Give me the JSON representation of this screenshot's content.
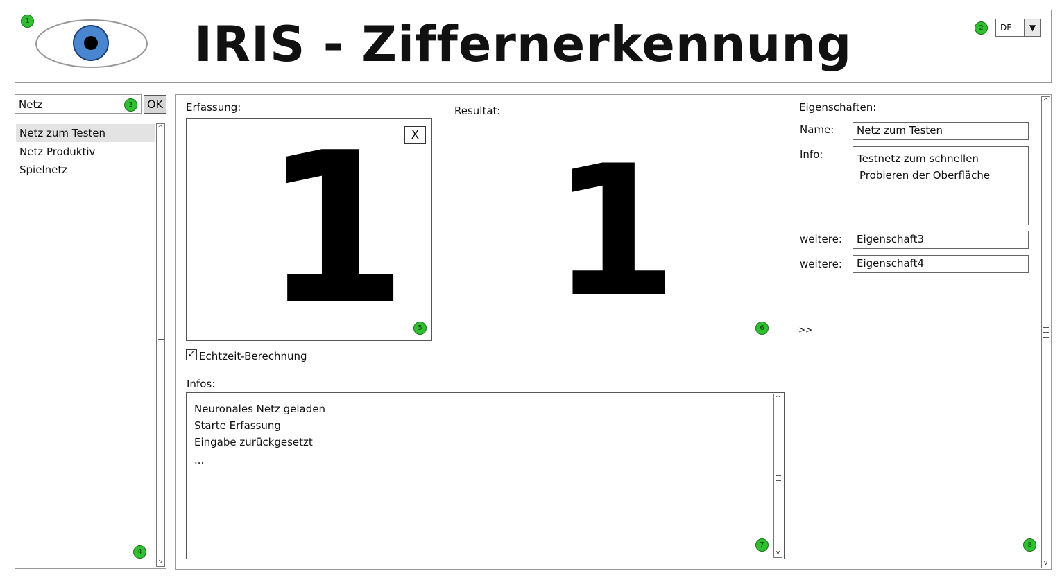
{
  "header": {
    "title": "IRIS - Ziffernerkennung",
    "badge": "1",
    "language": {
      "value": "DE",
      "badge": "2"
    },
    "logo_icon": "eye-icon",
    "eye_color": "#4a86cf"
  },
  "sidebar": {
    "search": {
      "value": "Netz",
      "badge": "3"
    },
    "ok_label": "OK",
    "items": [
      {
        "label": "Netz zum Testen"
      },
      {
        "label": "Netz Produktiv"
      },
      {
        "label": "Spielnetz"
      }
    ],
    "badge": "4"
  },
  "capture": {
    "label": "Erfassung:",
    "clear_label": "X",
    "drawn_digit": "1",
    "badge": "5",
    "realtime_label": "Echtzeit-Berechnung"
  },
  "result": {
    "label": "Resultat:",
    "digit": "1",
    "badge": "6"
  },
  "infos": {
    "label": "Infos:",
    "lines": [
      "Neuronales Netz geladen",
      "Starte Erfassung",
      "Eingabe zurückgesetzt",
      "..."
    ],
    "badge": "7"
  },
  "properties": {
    "title": "Eigenschaften:",
    "name_label": "Name:",
    "name_value": "Netz zum Testen",
    "info_label": "Info:",
    "info_line1": "Testnetz zum schnellen",
    "info_line2": "Probieren der Oberfläche",
    "more1_label": "weitere:",
    "more1_value": "Eigenschaft3",
    "more2_label": "weitere:",
    "more2_value": "Eigenschaft4",
    "expand_label": ">>",
    "badge": "8"
  },
  "colors": {
    "badge": "#2fc02f",
    "selection": "#e3e3e3"
  }
}
